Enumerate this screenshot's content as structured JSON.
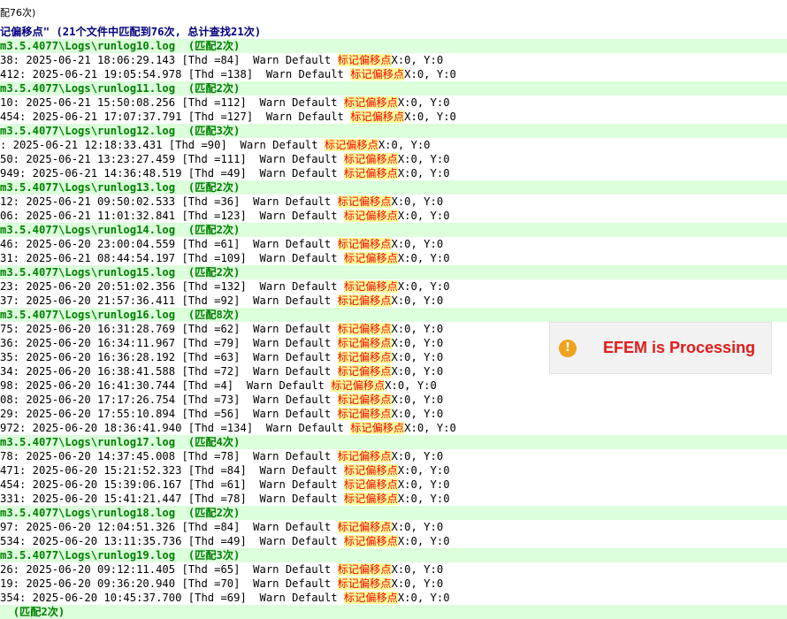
{
  "window": {
    "title_fragment": "配76次)"
  },
  "summary": {
    "pattern": "记偏移点\"",
    "stats": "(21个文件中匹配到76次, 总计查找21次)"
  },
  "search_term": "标记偏移点",
  "groups": [
    {
      "file": "m3.5.4077\\Logs\\runlog10.log",
      "count": "(匹配2次)",
      "lines": [
        {
          "prefix": "38: 2025-06-21 18:06:29.143 [Thd =84]  Warn Default ",
          "suffix": "X:0, Y:0"
        },
        {
          "prefix": "412: 2025-06-21 19:05:54.978 [Thd =138]  Warn Default ",
          "suffix": "X:0, Y:0"
        }
      ]
    },
    {
      "file": "m3.5.4077\\Logs\\runlog11.log",
      "count": "(匹配2次)",
      "lines": [
        {
          "prefix": "10: 2025-06-21 15:50:08.256 [Thd =112]  Warn Default ",
          "suffix": "X:0, Y:0"
        },
        {
          "prefix": "454: 2025-06-21 17:07:37.791 [Thd =127]  Warn Default ",
          "suffix": "X:0, Y:0"
        }
      ]
    },
    {
      "file": "m3.5.4077\\Logs\\runlog12.log",
      "count": "(匹配3次)",
      "lines": [
        {
          "prefix": ": 2025-06-21 12:18:33.431 [Thd =90]  Warn Default ",
          "suffix": "X:0, Y:0"
        },
        {
          "prefix": "50: 2025-06-21 13:23:27.459 [Thd =111]  Warn Default ",
          "suffix": "X:0, Y:0"
        },
        {
          "prefix": "949: 2025-06-21 14:36:48.519 [Thd =49]  Warn Default ",
          "suffix": "X:0, Y:0"
        }
      ]
    },
    {
      "file": "m3.5.4077\\Logs\\runlog13.log",
      "count": "(匹配2次)",
      "lines": [
        {
          "prefix": "12: 2025-06-21 09:50:02.533 [Thd =36]  Warn Default ",
          "suffix": "X:0, Y:0"
        },
        {
          "prefix": "06: 2025-06-21 11:01:32.841 [Thd =123]  Warn Default ",
          "suffix": "X:0, Y:0"
        }
      ]
    },
    {
      "file": "m3.5.4077\\Logs\\runlog14.log",
      "count": "(匹配2次)",
      "lines": [
        {
          "prefix": "46: 2025-06-20 23:00:04.559 [Thd =61]  Warn Default ",
          "suffix": "X:0, Y:0"
        },
        {
          "prefix": "31: 2025-06-21 08:44:54.197 [Thd =109]  Warn Default ",
          "suffix": "X:0, Y:0"
        }
      ]
    },
    {
      "file": "m3.5.4077\\Logs\\runlog15.log",
      "count": "(匹配2次)",
      "lines": [
        {
          "prefix": "23: 2025-06-20 20:51:02.356 [Thd =132]  Warn Default ",
          "suffix": "X:0, Y:0"
        },
        {
          "prefix": "37: 2025-06-20 21:57:36.411 [Thd =92]  Warn Default ",
          "suffix": "X:0, Y:0"
        }
      ]
    },
    {
      "file": "m3.5.4077\\Logs\\runlog16.log",
      "count": "(匹配8次)",
      "lines": [
        {
          "prefix": "75: 2025-06-20 16:31:28.769 [Thd =62]  Warn Default ",
          "suffix": "X:0, Y:0"
        },
        {
          "prefix": "36: 2025-06-20 16:34:11.967 [Thd =79]  Warn Default ",
          "suffix": "X:0, Y:0"
        },
        {
          "prefix": "35: 2025-06-20 16:36:28.192 [Thd =63]  Warn Default ",
          "suffix": "X:0, Y:0"
        },
        {
          "prefix": "34: 2025-06-20 16:38:41.588 [Thd =72]  Warn Default ",
          "suffix": "X:0, Y:0"
        },
        {
          "prefix": "98: 2025-06-20 16:41:30.744 [Thd =4]  Warn Default ",
          "suffix": "X:0, Y:0"
        },
        {
          "prefix": "08: 2025-06-20 17:17:26.754 [Thd =73]  Warn Default ",
          "suffix": "X:0, Y:0"
        },
        {
          "prefix": "29: 2025-06-20 17:55:10.894 [Thd =56]  Warn Default ",
          "suffix": "X:0, Y:0"
        },
        {
          "prefix": "972: 2025-06-20 18:36:41.940 [Thd =134]  Warn Default ",
          "suffix": "X:0, Y:0"
        }
      ]
    },
    {
      "file": "m3.5.4077\\Logs\\runlog17.log",
      "count": "(匹配4次)",
      "lines": [
        {
          "prefix": "78: 2025-06-20 14:37:45.008 [Thd =78]  Warn Default ",
          "suffix": "X:0, Y:0"
        },
        {
          "prefix": "471: 2025-06-20 15:21:52.323 [Thd =84]  Warn Default ",
          "suffix": "X:0, Y:0"
        },
        {
          "prefix": "454: 2025-06-20 15:39:06.167 [Thd =61]  Warn Default ",
          "suffix": "X:0, Y:0"
        },
        {
          "prefix": "331: 2025-06-20 15:41:21.447 [Thd =78]  Warn Default ",
          "suffix": "X:0, Y:0"
        }
      ]
    },
    {
      "file": "m3.5.4077\\Logs\\runlog18.log",
      "count": "(匹配2次)",
      "lines": [
        {
          "prefix": "97: 2025-06-20 12:04:51.326 [Thd =84]  Warn Default ",
          "suffix": "X:0, Y:0"
        },
        {
          "prefix": "534: 2025-06-20 13:11:35.736 [Thd =49]  Warn Default ",
          "suffix": "X:0, Y:0"
        }
      ]
    },
    {
      "file": "m3.5.4077\\Logs\\runlog19.log",
      "count": "(匹配3次)",
      "lines": [
        {
          "prefix": "26: 2025-06-20 09:12:11.405 [Thd =65]  Warn Default ",
          "suffix": "X:0, Y:0"
        },
        {
          "prefix": "19: 2025-06-20 09:36:20.940 [Thd =70]  Warn Default ",
          "suffix": "X:0, Y:0"
        },
        {
          "prefix": "354: 2025-06-20 10:45:37.700 [Thd =69]  Warn Default ",
          "suffix": "X:0, Y:0"
        }
      ]
    },
    {
      "file": "",
      "count": "(匹配2次)",
      "lines": []
    }
  ],
  "toast": {
    "icon": "alert-circle-icon",
    "text": "EFEM is Processing",
    "icon_color": "#f0a21c",
    "text_color": "#e31b1b"
  }
}
